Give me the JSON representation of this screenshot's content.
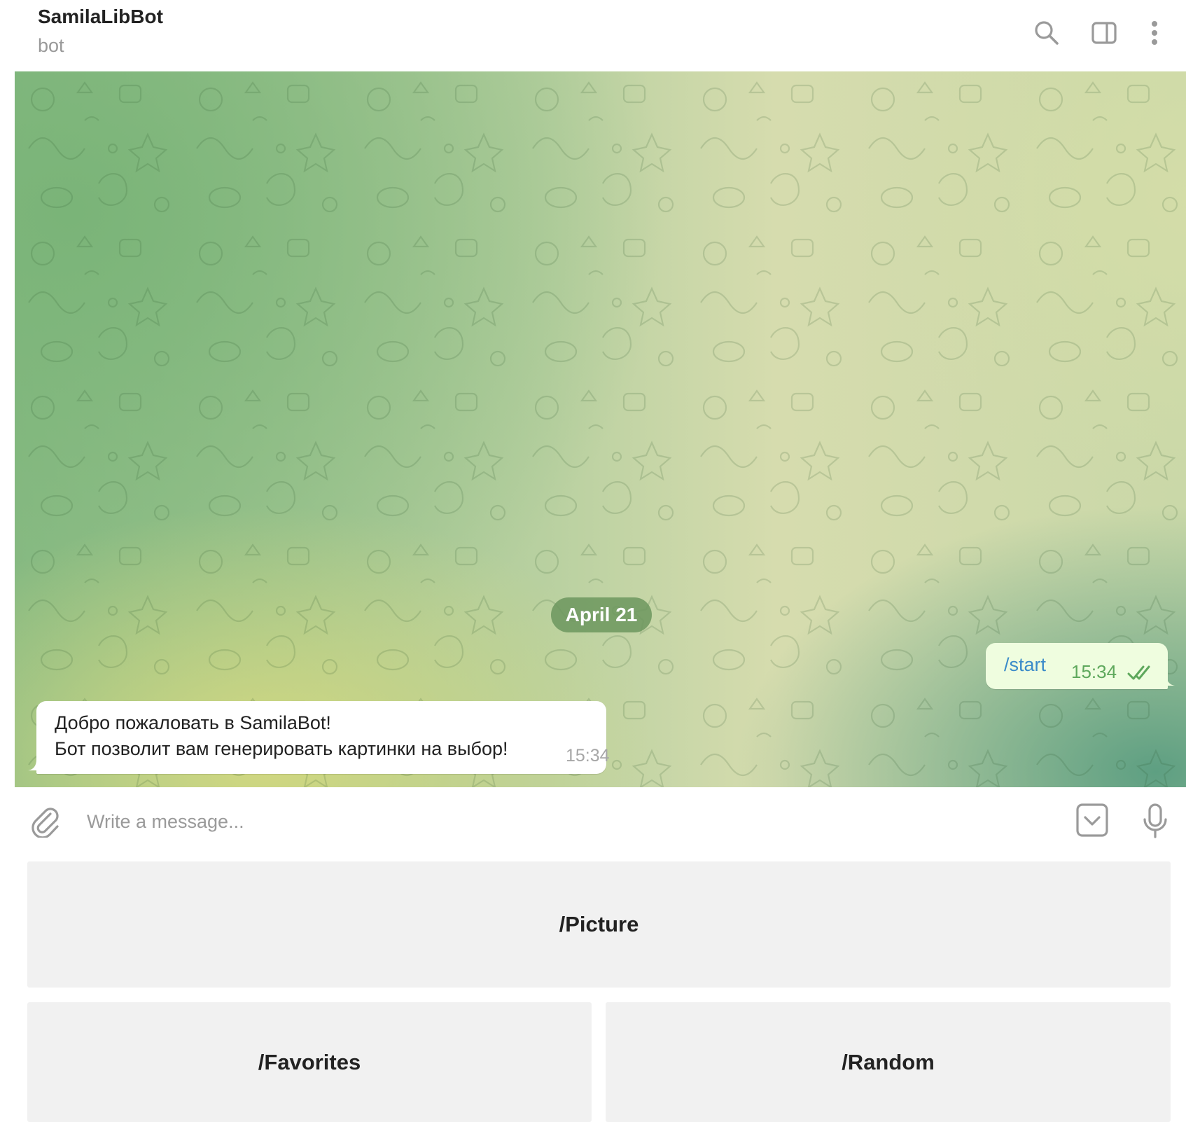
{
  "header": {
    "title": "SamilaLibBot",
    "subtitle": "bot",
    "icons": [
      "search-icon",
      "sidebar-toggle-icon",
      "more-vertical-icon"
    ]
  },
  "chat": {
    "date_label": "April 21",
    "messages": [
      {
        "direction": "outgoing",
        "text": "/start",
        "time": "15:34",
        "status": "read"
      },
      {
        "direction": "incoming",
        "lines": [
          "Добро пожаловать в SamilaBot!",
          "Бот позволит вам генерировать картинки на выбор!"
        ],
        "time": "15:34"
      }
    ]
  },
  "composer": {
    "placeholder": "Write a message...",
    "value": "",
    "icons": [
      "paperclip-icon",
      "keyboard-toggle-icon",
      "microphone-icon"
    ]
  },
  "bot_keyboard": {
    "rows": [
      [
        "/Picture"
      ],
      [
        "/Favorites",
        "/Random"
      ]
    ]
  },
  "colors": {
    "outgoing_bubble": "#effddf",
    "incoming_bubble": "#ffffff",
    "accent_link": "#3a8bc9",
    "check_green": "#5ea85c",
    "keyboard_button": "#f1f1f1"
  }
}
